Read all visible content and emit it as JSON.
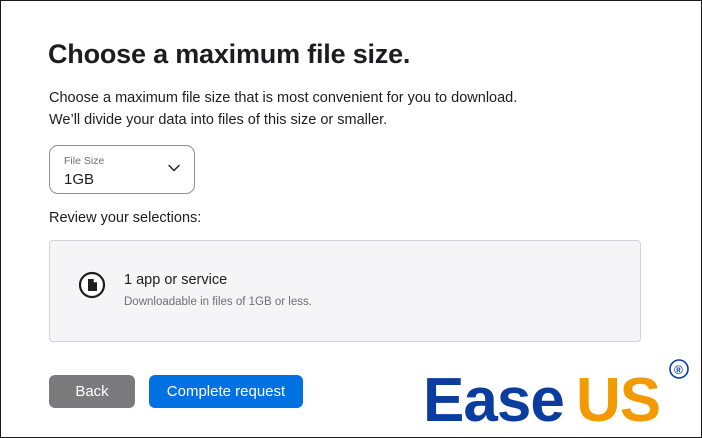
{
  "page": {
    "title": "Choose a maximum file size.",
    "description_line1": "Choose a maximum file size that is most convenient for you to download.",
    "description_line2": "We’ll divide your data into files of this size or smaller."
  },
  "file_size_select": {
    "label": "File Size",
    "value": "1GB"
  },
  "review": {
    "label": "Review your selections:",
    "item_title": "1 app or service",
    "item_subtitle": "Downloadable in files of 1GB or less."
  },
  "buttons": {
    "back_label": "Back",
    "complete_label": "Complete request"
  },
  "watermark": {
    "text_ease": "Ease",
    "text_us": "US",
    "registered_mark": "®"
  },
  "colors": {
    "primary_button": "#0071e3",
    "secondary_button": "#7b7b7e",
    "logo_blue": "#0a3d9e",
    "logo_orange": "#f29a00"
  },
  "icons": {
    "select_chevron": "chevron-down-icon",
    "summary_item": "document-icon"
  }
}
